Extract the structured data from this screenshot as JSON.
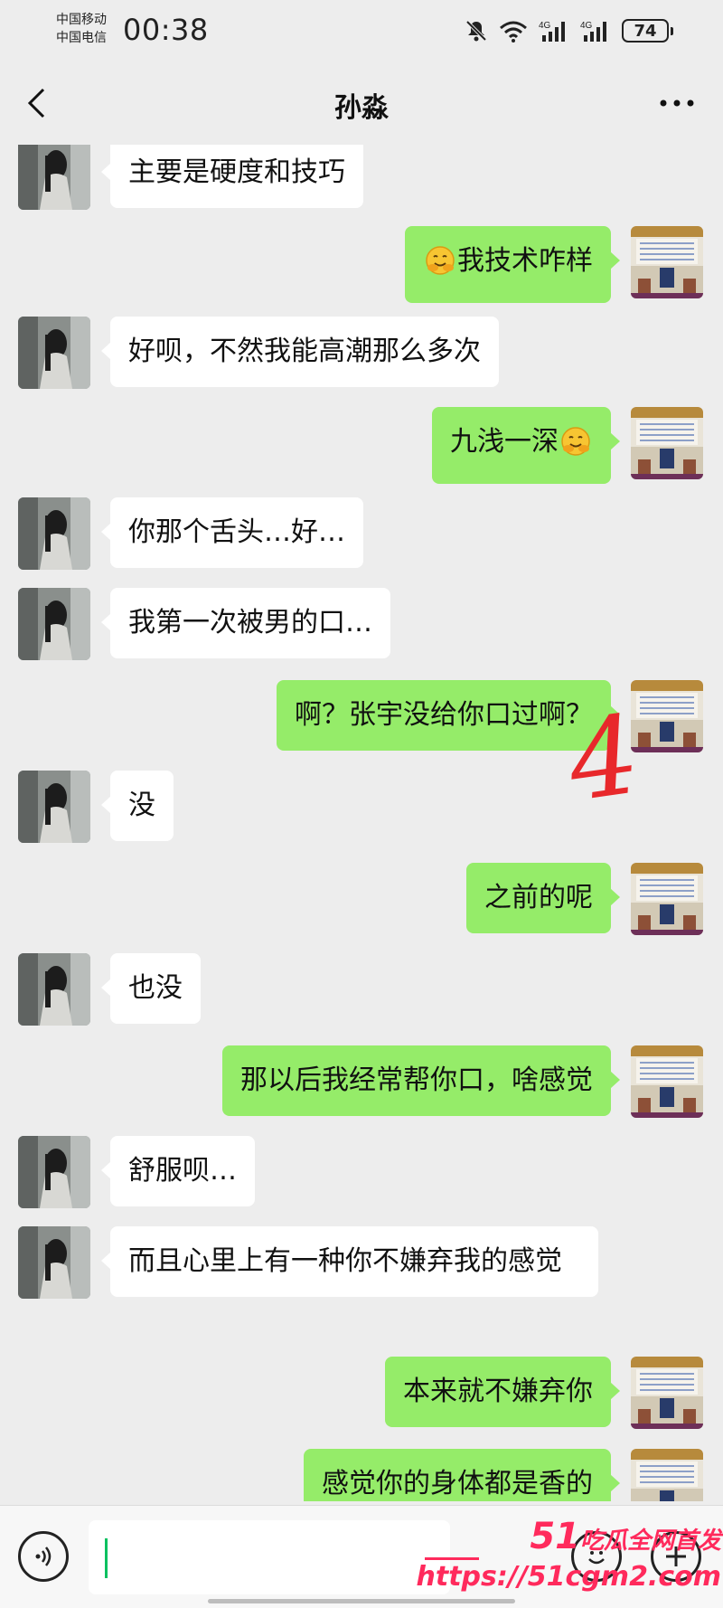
{
  "status_bar": {
    "carrier_1": "中国移动",
    "carrier_2": "中国电信",
    "time": "00:38",
    "battery": "74"
  },
  "header": {
    "title": "孙淼"
  },
  "messages": [
    {
      "side": "in",
      "text": "主要是硬度和技巧"
    },
    {
      "side": "out",
      "text": "我技术咋样",
      "emoji": "hugging-face-emoji"
    },
    {
      "side": "in",
      "text": "好呗，不然我能高潮那么多次"
    },
    {
      "side": "out",
      "text": "九浅一深",
      "emoji": "hugging-face-emoji"
    },
    {
      "side": "in",
      "text": "你那个舌头…好…"
    },
    {
      "side": "in",
      "text": "我第一次被男的口…"
    },
    {
      "side": "out",
      "text": "啊？张宇没给你口过啊？"
    },
    {
      "side": "in",
      "text": "没"
    },
    {
      "side": "out",
      "text": "之前的呢"
    },
    {
      "side": "in",
      "text": "也没"
    },
    {
      "side": "out",
      "text": "那以后我经常帮你口，啥感觉"
    },
    {
      "side": "in",
      "text": "舒服呗…"
    },
    {
      "side": "in",
      "text": "而且心里上有一种你不嫌弃我的感觉"
    },
    {
      "side": "out",
      "text": "本来就不嫌弃你"
    },
    {
      "side": "out",
      "text": "感觉你的身体都是香的"
    }
  ],
  "annotation": "4",
  "watermark": {
    "number": "51",
    "slogan": "吃瓜全网首发",
    "url": "https://51cgm2.com"
  },
  "colors": {
    "background": "#ededed",
    "outgoing_bubble": "#95ec69",
    "incoming_bubble": "#ffffff",
    "annotation": "#e8282b",
    "watermark": "#ff2a5c"
  }
}
